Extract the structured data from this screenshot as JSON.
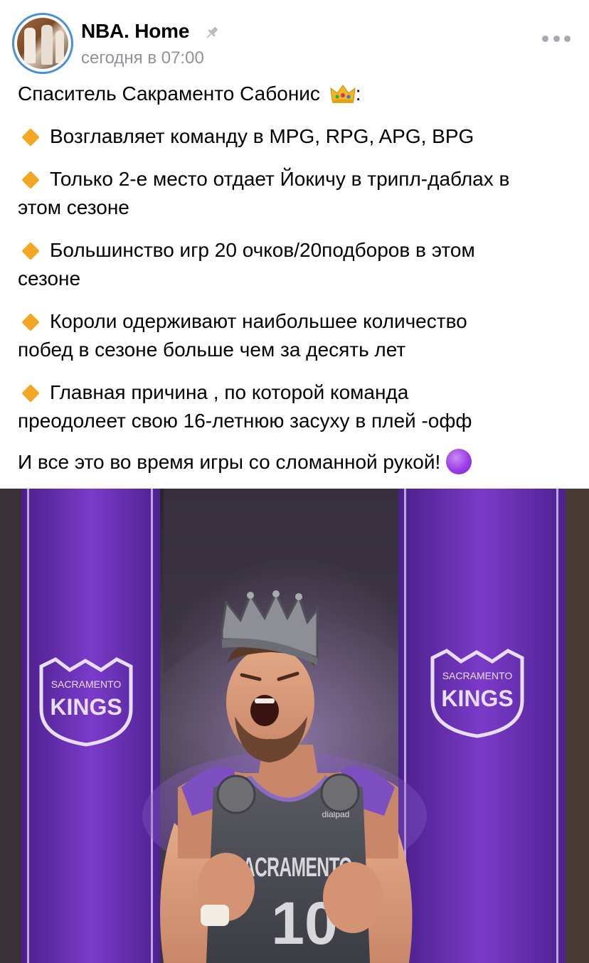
{
  "post": {
    "group_name": "NBA. Home",
    "time": "сегодня в 07:00",
    "intro": "Спаситель Сакраменто Сабонис",
    "intro_suffix": ":",
    "bullets": [
      {
        "lines": [
          "Возглавляет команду в MPG, RPG, APG, BPG"
        ]
      },
      {
        "lines": [
          "Только 2-е место отдает Йокичу в трипл-даблах в",
          "этом сезоне"
        ]
      },
      {
        "lines": [
          "Большинство игр 20 очков/20подборов в этом",
          "сезоне"
        ]
      },
      {
        "lines": [
          "Короли одерживают наибольшее количество",
          "побед в сезоне больше чем за десять лет"
        ]
      },
      {
        "lines": [
          "Главная причина , по которой команда",
          "преодолеет свою 16-летнюю засуху в плей -офф"
        ]
      }
    ],
    "closing": "И все это во время игры со сломанной рукой!"
  },
  "image": {
    "banner_text_top": "SACRAMENTO",
    "banner_text_main": "KINGS",
    "jersey_team": "SACRAMENTO",
    "jersey_number": "10",
    "jersey_sponsor": "dialpad"
  },
  "icons": {
    "pin": "pin-icon",
    "more": "more-dots-icon",
    "crown": "crown-emoji-icon",
    "diamond": "orange-diamond-emoji-icon",
    "purple": "purple-circle-emoji-icon"
  },
  "colors": {
    "accent_ring": "#4a8fd9",
    "meta_gray": "#8e939a",
    "diamond": "#f5a623",
    "purple": "#9b3de6",
    "banner": "#6b2fb3"
  }
}
